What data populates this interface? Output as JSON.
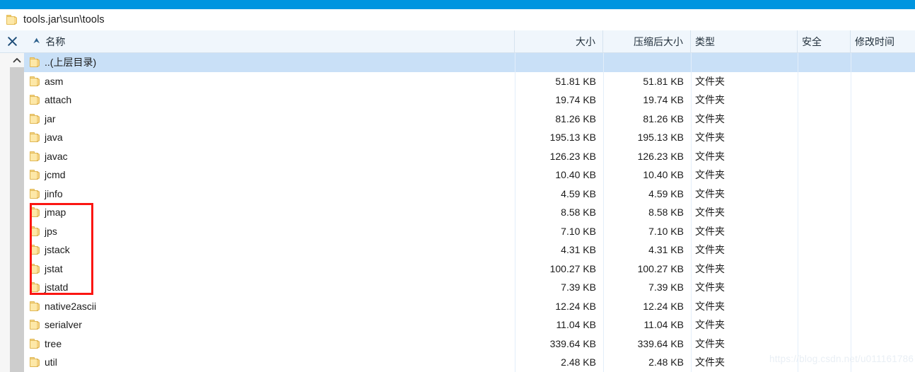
{
  "window": {
    "accent_color": "#0095e0",
    "path_icon": "folder-icon",
    "path": "tools.jar\\sun\\tools"
  },
  "toolbar": {
    "close_label": "×"
  },
  "table": {
    "sort_indicator": "⮝",
    "columns": [
      {
        "key": "name",
        "label": "名称",
        "align": "left"
      },
      {
        "key": "size",
        "label": "大小",
        "align": "right"
      },
      {
        "key": "compressed",
        "label": "压缩后大小",
        "align": "right"
      },
      {
        "key": "type",
        "label": "类型",
        "align": "left"
      },
      {
        "key": "security",
        "label": "安全",
        "align": "left"
      },
      {
        "key": "modified",
        "label": "修改时间",
        "align": "left"
      }
    ],
    "rows": [
      {
        "name": "..(上层目录)",
        "size": "",
        "compressed": "",
        "type": "",
        "security": "",
        "modified": "",
        "selected": true,
        "icon": "folder-icon"
      },
      {
        "name": "asm",
        "size": "51.81 KB",
        "compressed": "51.81 KB",
        "type": "文件夹",
        "security": "",
        "modified": "",
        "selected": false,
        "icon": "folder-icon"
      },
      {
        "name": "attach",
        "size": "19.74 KB",
        "compressed": "19.74 KB",
        "type": "文件夹",
        "security": "",
        "modified": "",
        "selected": false,
        "icon": "folder-icon"
      },
      {
        "name": "jar",
        "size": "81.26 KB",
        "compressed": "81.26 KB",
        "type": "文件夹",
        "security": "",
        "modified": "",
        "selected": false,
        "icon": "folder-icon"
      },
      {
        "name": "java",
        "size": "195.13 KB",
        "compressed": "195.13 KB",
        "type": "文件夹",
        "security": "",
        "modified": "",
        "selected": false,
        "icon": "folder-icon"
      },
      {
        "name": "javac",
        "size": "126.23 KB",
        "compressed": "126.23 KB",
        "type": "文件夹",
        "security": "",
        "modified": "",
        "selected": false,
        "icon": "folder-icon"
      },
      {
        "name": "jcmd",
        "size": "10.40 KB",
        "compressed": "10.40 KB",
        "type": "文件夹",
        "security": "",
        "modified": "",
        "selected": false,
        "icon": "folder-icon"
      },
      {
        "name": "jinfo",
        "size": "4.59 KB",
        "compressed": "4.59 KB",
        "type": "文件夹",
        "security": "",
        "modified": "",
        "selected": false,
        "icon": "folder-icon"
      },
      {
        "name": "jmap",
        "size": "8.58 KB",
        "compressed": "8.58 KB",
        "type": "文件夹",
        "security": "",
        "modified": "",
        "selected": false,
        "icon": "folder-icon"
      },
      {
        "name": "jps",
        "size": "7.10 KB",
        "compressed": "7.10 KB",
        "type": "文件夹",
        "security": "",
        "modified": "",
        "selected": false,
        "icon": "folder-icon"
      },
      {
        "name": "jstack",
        "size": "4.31 KB",
        "compressed": "4.31 KB",
        "type": "文件夹",
        "security": "",
        "modified": "",
        "selected": false,
        "icon": "folder-icon"
      },
      {
        "name": "jstat",
        "size": "100.27 KB",
        "compressed": "100.27 KB",
        "type": "文件夹",
        "security": "",
        "modified": "",
        "selected": false,
        "icon": "folder-icon"
      },
      {
        "name": "jstatd",
        "size": "7.39 KB",
        "compressed": "7.39 KB",
        "type": "文件夹",
        "security": "",
        "modified": "",
        "selected": false,
        "icon": "folder-icon"
      },
      {
        "name": "native2ascii",
        "size": "12.24 KB",
        "compressed": "12.24 KB",
        "type": "文件夹",
        "security": "",
        "modified": "",
        "selected": false,
        "icon": "folder-icon"
      },
      {
        "name": "serialver",
        "size": "11.04 KB",
        "compressed": "11.04 KB",
        "type": "文件夹",
        "security": "",
        "modified": "",
        "selected": false,
        "icon": "folder-icon"
      },
      {
        "name": "tree",
        "size": "339.64 KB",
        "compressed": "339.64 KB",
        "type": "文件夹",
        "security": "",
        "modified": "",
        "selected": false,
        "icon": "folder-icon"
      },
      {
        "name": "util",
        "size": "2.48 KB",
        "compressed": "2.48 KB",
        "type": "文件夹",
        "security": "",
        "modified": "",
        "selected": false,
        "icon": "folder-icon"
      }
    ]
  },
  "annotation": {
    "color": "#fb1612",
    "covers": [
      "jmap",
      "jps",
      "jstack",
      "jstat",
      "jstatd"
    ]
  },
  "watermark": {
    "text": "https://blog.csdn.net/u011161786",
    "color": "#e9eff5"
  }
}
